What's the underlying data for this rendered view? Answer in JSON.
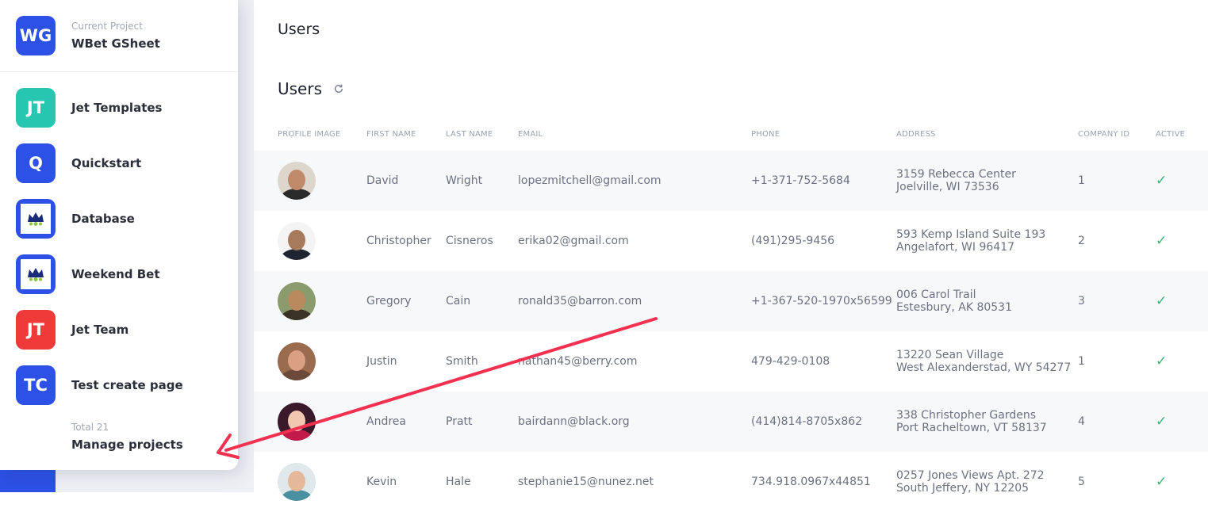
{
  "current_project": {
    "caption": "Current Project",
    "name": "WBet GSheet",
    "initials": "WG",
    "color": "#2d50e6"
  },
  "projects": [
    {
      "initials": "JT",
      "name": "Jet Templates",
      "color": "#27c6b0",
      "icon": "jt-tile"
    },
    {
      "initials": "Q",
      "name": "Quickstart",
      "color": "#2d50e6",
      "icon": "q-tile"
    },
    {
      "initials": "",
      "name": "Database",
      "color": "#2d50e6",
      "icon": "crown-logo-icon"
    },
    {
      "initials": "",
      "name": "Weekend Bet",
      "color": "#2d50e6",
      "icon": "crown-logo-icon"
    },
    {
      "initials": "JT",
      "name": "Jet Team",
      "color": "#f03a3a",
      "icon": "jt-tile"
    },
    {
      "initials": "TC",
      "name": "Test create page",
      "color": "#2d50e6",
      "icon": "tc-tile"
    }
  ],
  "total_label": "Total 21",
  "manage_label": "Manage projects",
  "page_title": "Users",
  "section_title": "Users",
  "table": {
    "columns": [
      "PROFILE IMAGE",
      "FIRST NAME",
      "LAST NAME",
      "EMAIL",
      "PHONE",
      "ADDRESS",
      "COMPANY ID",
      "ACTIVE"
    ],
    "rows": [
      {
        "first": "David",
        "last": "Wright",
        "email": "lopezmitchell@gmail.com",
        "phone": "+1-371-752-5684",
        "address1": "3159 Rebecca Center",
        "address2": "Joelville, WI 73536",
        "company": "1",
        "active": "✓"
      },
      {
        "first": "Christopher",
        "last": "Cisneros",
        "email": "erika02@gmail.com",
        "phone": "(491)295-9456",
        "address1": "593 Kemp Island Suite 193",
        "address2": "Angelafort, WI 96417",
        "company": "2",
        "active": "✓"
      },
      {
        "first": "Gregory",
        "last": "Cain",
        "email": "ronald35@barron.com",
        "phone": "+1-367-520-1970x56599",
        "address1": "006 Carol Trail",
        "address2": "Estesbury, AK 80531",
        "company": "3",
        "active": "✓"
      },
      {
        "first": "Justin",
        "last": "Smith",
        "email": "nathan45@berry.com",
        "phone": "479-429-0108",
        "address1": "13220 Sean Village",
        "address2": "West Alexanderstad, WY 54277",
        "company": "1",
        "active": "✓"
      },
      {
        "first": "Andrea",
        "last": "Pratt",
        "email": "bairdann@black.org",
        "phone": "(414)814-8705x862",
        "address1": "338 Christopher Gardens",
        "address2": "Port Racheltown, VT 58137",
        "company": "4",
        "active": "✓"
      },
      {
        "first": "Kevin",
        "last": "Hale",
        "email": "stephanie15@nunez.net",
        "phone": "734.918.0967x44851",
        "address1": "0257 Jones Views Apt. 272",
        "address2": "South Jeffery, NY 12205",
        "company": "5",
        "active": "✓"
      }
    ]
  },
  "colors": {
    "accent": "#2d50e6",
    "annotation_arrow": "#f2304f",
    "active_check": "#3cb371"
  }
}
